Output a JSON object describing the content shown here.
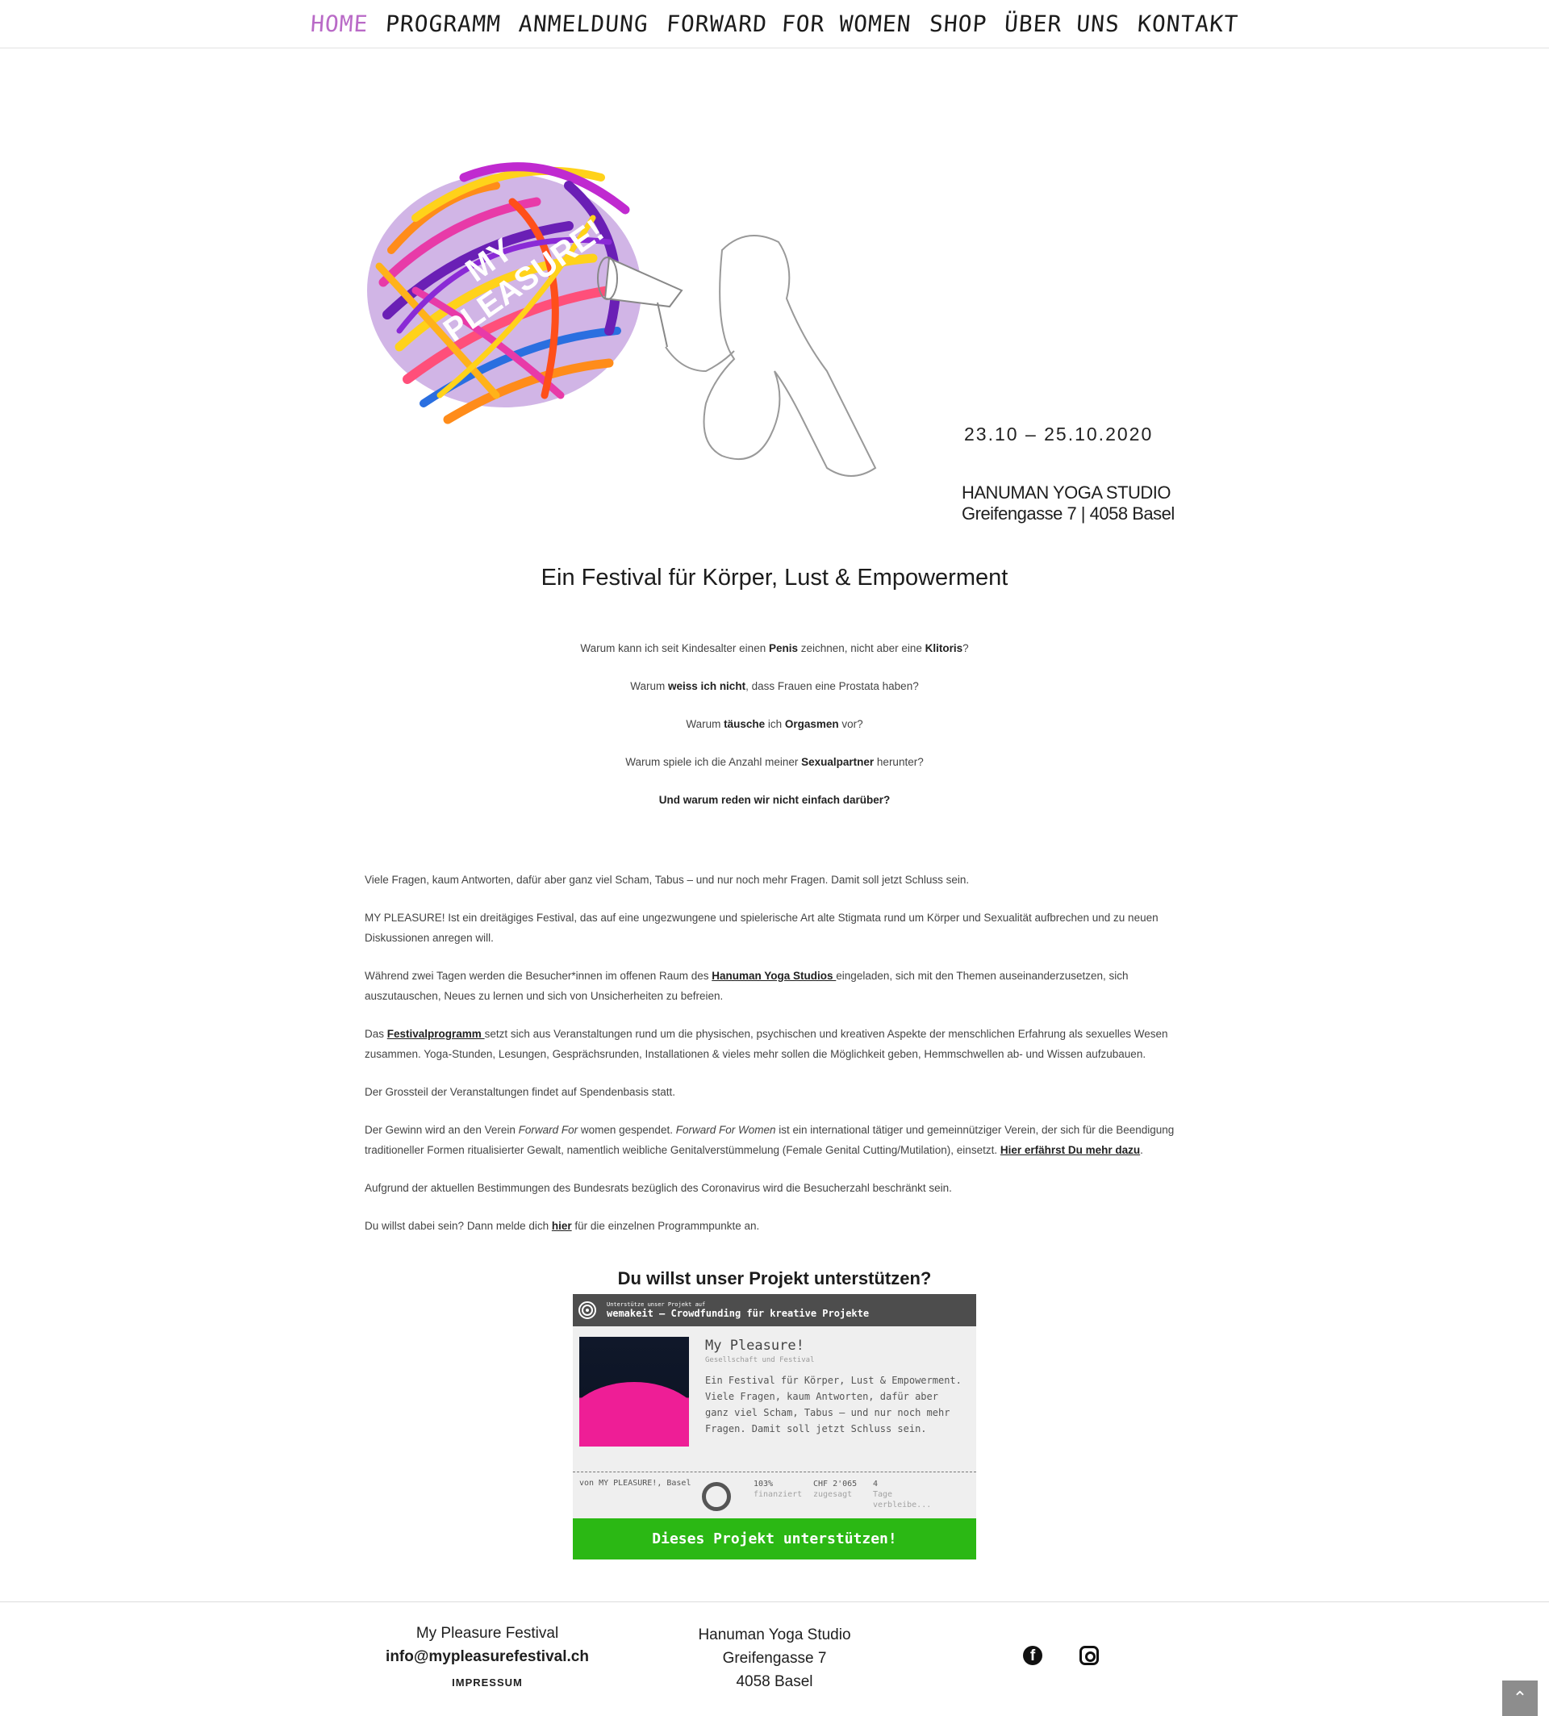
{
  "nav": {
    "items": [
      {
        "label": "HOME",
        "active": true
      },
      {
        "label": "PROGRAMM"
      },
      {
        "label": "ANMELDUNG"
      },
      {
        "label": "FORWARD FOR WOMEN"
      },
      {
        "label": "SHOP"
      },
      {
        "label": "ÜBER UNS"
      },
      {
        "label": "KONTAKT"
      }
    ]
  },
  "hero": {
    "logo_text_1": "MY",
    "logo_text_2": "PLEASURE!",
    "date": "23.10 – 25.10.2020",
    "venue_name": "HANUMAN YOGA STUDIO",
    "venue_address": "Greifengasse 7 | 4058 Basel"
  },
  "headline": "Ein Festival für Körper, Lust & Empowerment",
  "questions": {
    "q1_a": "Warum kann ich seit Kindesalter einen ",
    "q1_b": "Penis",
    "q1_c": " zeichnen, nicht aber eine ",
    "q1_d": "Klitoris",
    "q1_e": "?",
    "q2_a": "Warum ",
    "q2_b": "weiss ich nicht",
    "q2_c": ", dass Frauen eine Prostata haben?",
    "q3_a": "Warum ",
    "q3_b": "täusche",
    "q3_c": " ich ",
    "q3_d": "Orgasmen",
    "q3_e": " vor?",
    "q4_a": "Warum spiele ich die Anzahl meiner ",
    "q4_b": "Sexualpartner",
    "q4_c": " herunter?",
    "q5": "Und warum reden wir nicht einfach darüber?"
  },
  "body": {
    "p1": "Viele Fragen, kaum Antworten, dafür aber ganz viel Scham, Tabus – und nur noch mehr Fragen. Damit soll jetzt Schluss sein.",
    "p2": "MY PLEASURE! Ist ein dreitägiges Festival, das auf eine ungezwungene und spielerische Art alte Stigmata rund um Körper und Sexualität aufbrechen und zu neuen Diskussionen anregen will.",
    "p3_a": "Während zwei Tagen werden die Besucher*innen im offenen Raum des ",
    "p3_link": "Hanuman Yoga Studios ",
    "p3_b": "eingeladen, sich mit den Themen auseinanderzusetzen, sich auszutauschen, Neues zu lernen und sich von Unsicherheiten zu befreien.",
    "p4_a": "Das ",
    "p4_link": "Festivalprogramm ",
    "p4_b": "setzt sich aus Veranstaltungen rund um die physischen, psychischen und kreativen Aspekte der menschlichen Erfahrung als sexuelles Wesen zusammen. Yoga-Stunden, Lesungen, Gesprächsrunden, Installationen & vieles mehr sollen die Möglichkeit geben, Hemmschwellen ab-  und Wissen aufzubauen.",
    "p5": "Der Grossteil der Veranstaltungen findet auf Spendenbasis statt.",
    "p6_a": "Der Gewinn wird an den Verein ",
    "p6_em1": "Forward For",
    "p6_b": " women gespendet. ",
    "p6_em2": "Forward For Women",
    "p6_c": " ist ein international tätiger und gemeinnütziger Verein, der sich für die Beendigung traditioneller Formen ritualisierter Gewalt, namentlich weibliche Genitalverstümmelung (Female Genital Cutting/Mutilation), einsetzt. ",
    "p6_link": "Hier erfährst Du mehr dazu",
    "p6_d": ".",
    "p7": "Aufgrund der aktuellen Bestimmungen des Bundesrats bezüglich des Coronavirus wird die Besucherzahl beschränkt sein.",
    "p8_a": "Du willst dabei sein? Dann melde dich ",
    "p8_link": "hier",
    "p8_b": " für die einzelnen Programmpunkte an."
  },
  "support": {
    "title": "Du willst unser Projekt unterstützen?",
    "bar_small": "Unterstütze unser Projekt auf",
    "bar_big": "wemakeit – Crowdfunding für kreative Projekte",
    "project_title": "My Pleasure!",
    "project_category": "Gesellschaft und Festival",
    "project_desc": "Ein Festival für Körper, Lust & Empowerment. Viele Fragen, kaum Antworten, dafür aber ganz viel Scham, Tabus – und nur noch mehr Fragen. Damit soll jetzt Schluss sein.",
    "by": "von MY PLEASURE!, Basel",
    "funded_value": "103%",
    "funded_label": "finanziert",
    "pledged_value": "CHF 2'065",
    "pledged_label": "zugesagt",
    "days_value": "4",
    "days_label": "Tage verbleibe...",
    "cta": "Dieses Projekt unterstützen!"
  },
  "footer": {
    "org": "My Pleasure Festival",
    "email": "info@mypleasurefestival.ch",
    "impressum": "IMPRESSUM",
    "venue_line1": "Hanuman Yoga Studio",
    "venue_line2": "Greifengasse 7",
    "venue_line3": "4058 Basel",
    "fb_glyph": "f",
    "to_top_glyph": "⌃"
  },
  "colors": {
    "nav_active": "#b96ac7",
    "cta_green": "#2bb814",
    "widget_bar": "#4d4d4d"
  },
  "icons": [
    "facebook-icon",
    "instagram-icon",
    "scroll-top-icon",
    "wemakeit-logo-icon"
  ]
}
